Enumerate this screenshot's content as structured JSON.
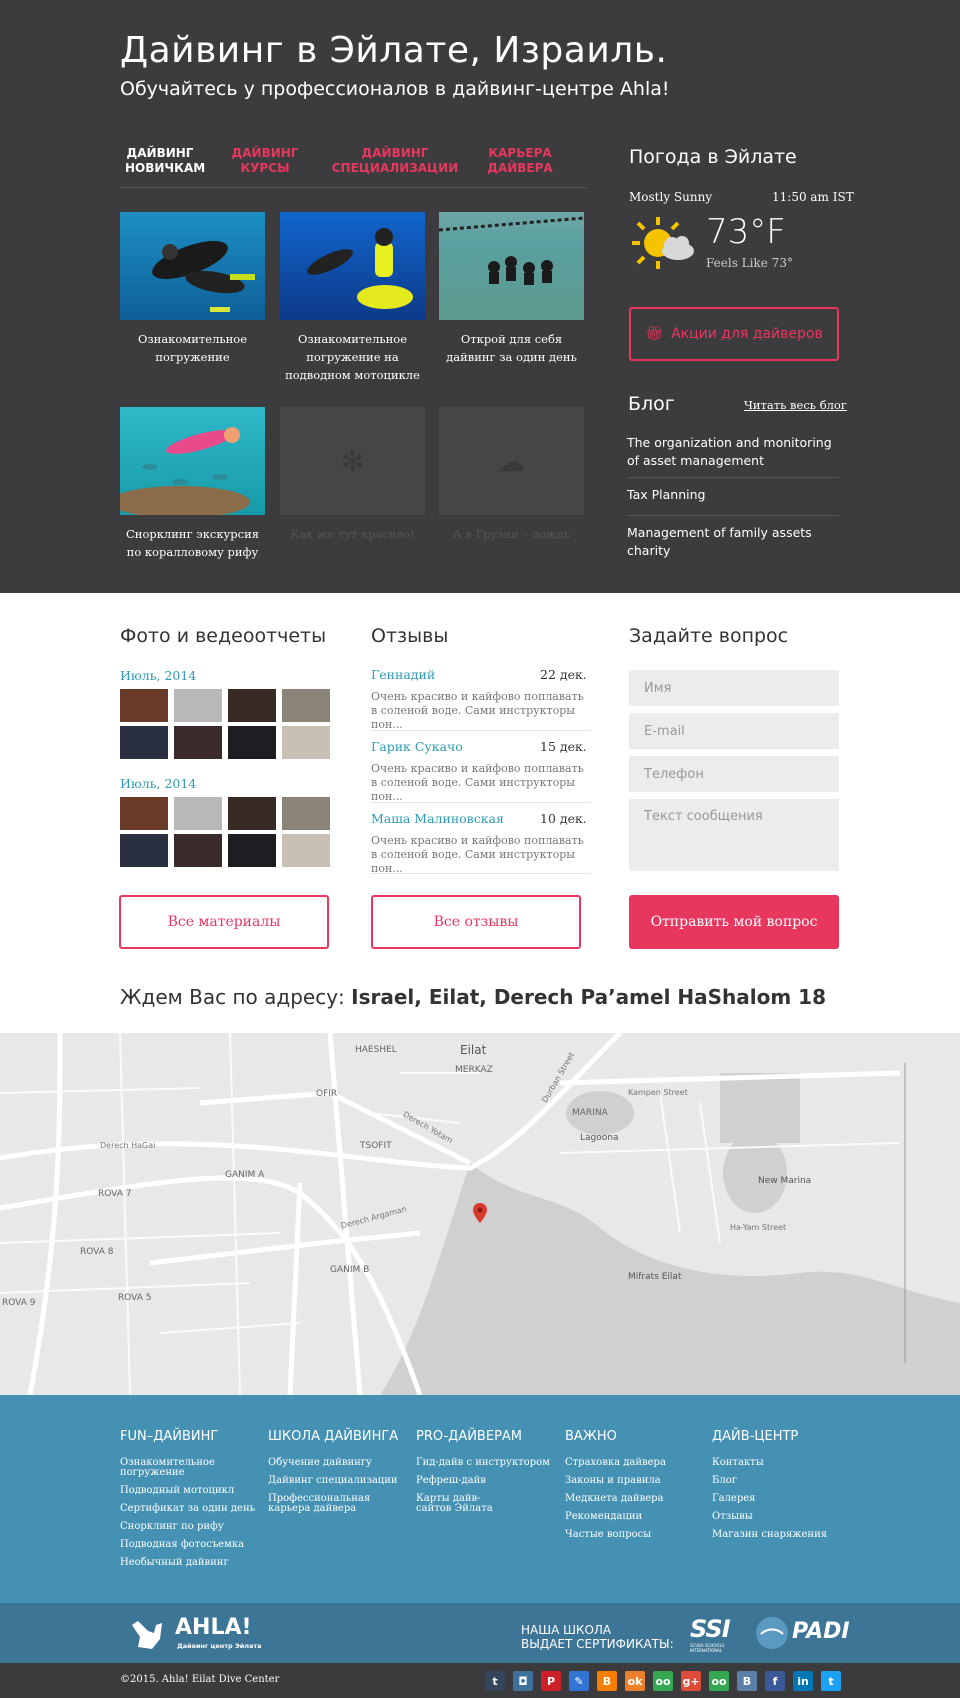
{
  "hero": {
    "title": "Дайвинг в Эйлате, Израиль.",
    "subtitle": "Обучайтесь у профессионалов в дайвинг-центре Ahla!"
  },
  "tabs": [
    {
      "l1": "ДАЙВИНГ",
      "l2": "НОВИЧКАМ"
    },
    {
      "l1": "ДАЙВИНГ",
      "l2": "КУРСЫ"
    },
    {
      "l1": "ДАЙВИНГ",
      "l2": "СПЕЦИАЛИЗАЦИИ"
    },
    {
      "l1": "КАРЬЕРА",
      "l2": "ДАЙВЕРА"
    }
  ],
  "cards": [
    "Ознакомительное погружение",
    "Ознакомительное погружение на подводном мотоцикле",
    "Открой для себя дайвинг за один день",
    "Снорклинг экскурсия по коралловому рифу",
    "Как же тут красиво!",
    "А в Грузии – дождь"
  ],
  "weather": {
    "title": "Погода в Эйлате",
    "condition": "Mostly Sunny",
    "time": "11:50 am IST",
    "temp": "73°F",
    "feels": "Feels Like 73°"
  },
  "promo": "Акции для дайверов",
  "blog": {
    "title": "Блог",
    "link": "Читать весь блог",
    "posts": [
      "The organization and monitoring of asset management",
      "Tax Planning",
      "Management of family assets charity"
    ]
  },
  "photos": {
    "title": "Фото и ведеоотчеты",
    "months": [
      "Июль, 2014",
      "Июль, 2014"
    ],
    "button": "Все материалы"
  },
  "reviews": {
    "title": "Отзывы",
    "items": [
      {
        "name": "Геннадий",
        "date": "22 дек.",
        "text": "Очень красиво и кайфово поплавать в соленой воде. Сами инструкторы пон..."
      },
      {
        "name": "Гарик Сукачо",
        "date": "15 дек.",
        "text": "Очень красиво и кайфово поплавать в соленой воде. Сами инструкторы пон..."
      },
      {
        "name": "Маша Малиновская",
        "date": "10 дек.",
        "text": "Очень красиво и кайфово поплавать в соленой воде. Сами инструкторы пон..."
      }
    ],
    "button": "Все отзывы"
  },
  "question": {
    "title": "Задайте вопрос",
    "name": "Имя",
    "email": "E-mail",
    "phone": "Телефон",
    "message": "Текст сообщения",
    "submit": "Отправить мой вопрос"
  },
  "address": {
    "lead": "Ждем Вас по адресу: ",
    "value": "Israel, Eilat, Derech Pa’amel HaShalom 18"
  },
  "map_labels": [
    "Eilat",
    "HAESHEL",
    "MERKAZ",
    "OFIR",
    "TSOFIT",
    "MARINA",
    "Lagoona",
    "GANIM A",
    "ROVA 7",
    "ROVA 8",
    "ROVA 5",
    "ROVA 9",
    "GANIM B",
    "New Marina",
    "Mifrats Eilat",
    "Derech Yotam",
    "Derech HaGai",
    "Durban Street",
    "Kampen Street",
    "Ha-Yam Street",
    "Derech Argaman"
  ],
  "footer": {
    "cols": [
      {
        "title": "FUN–ДАЙВИНГ",
        "links": [
          "Ознакомительное погружение",
          "Подводный мотоцикл",
          "Сертификат за один день",
          "Снорклинг по рифу",
          "Подводная фотосъемка",
          "Необычный дайвинг"
        ]
      },
      {
        "title": "ШКОЛА ДАЙВИНГА",
        "links": [
          "Обучение дайвингу",
          "Дайвинг специализации",
          "Профессиональная карьера дайвера"
        ]
      },
      {
        "title": "PRO-ДАЙВЕРАМ",
        "links": [
          "Гид-дайв с инструктором",
          "Рефреш-дайв",
          "Карты дайв- сайтов Эйлата"
        ]
      },
      {
        "title": "ВАЖНО",
        "links": [
          "Страховка дайвера",
          "Законы и правила",
          "Медкнета дайвера",
          "Рекомендации",
          "Частые вопросы"
        ]
      },
      {
        "title": "ДАЙВ-ЦЕНТР",
        "links": [
          "Контакты",
          "Блог",
          "Галерея",
          "Отзывы",
          "Магазин снаряжения"
        ]
      }
    ],
    "logo": "AHLA!",
    "logo_sub": "Дайвинг центр Эйлата",
    "cert_l1": "НАША ШКОЛА",
    "cert_l2": "ВЫДАЕТ СЕРТИФИКАТЫ:",
    "ssi": "SSI",
    "ssi_sub": "SCUBA SCHOOLS INTERNATIONAL",
    "padi": "PADI",
    "copyright": "©2015. Ahla! Eilat Dive Center"
  },
  "social": [
    {
      "name": "tumblr-icon",
      "g": "t",
      "c": "#35465c"
    },
    {
      "name": "instagram-icon",
      "g": "◘",
      "c": "#3f729b"
    },
    {
      "name": "pinterest-icon",
      "g": "P",
      "c": "#cb2027"
    },
    {
      "name": "delicious-icon",
      "g": "✎",
      "c": "#3274d1"
    },
    {
      "name": "blogger-icon",
      "g": "B",
      "c": "#f57d00"
    },
    {
      "name": "odnoklassniki-icon",
      "g": "ok",
      "c": "#ed812b"
    },
    {
      "name": "tripadvisor-icon",
      "g": "oo",
      "c": "#34a853"
    },
    {
      "name": "googleplus-icon",
      "g": "g+",
      "c": "#dd4b39"
    },
    {
      "name": "tripadvisor2-icon",
      "g": "oo",
      "c": "#34a853"
    },
    {
      "name": "vk-icon",
      "g": "B",
      "c": "#5b7fa6"
    },
    {
      "name": "facebook-icon",
      "g": "f",
      "c": "#3b5998"
    },
    {
      "name": "linkedin-icon",
      "g": "in",
      "c": "#0077b5"
    },
    {
      "name": "twitter-icon",
      "g": "t",
      "c": "#1da1f2"
    }
  ]
}
